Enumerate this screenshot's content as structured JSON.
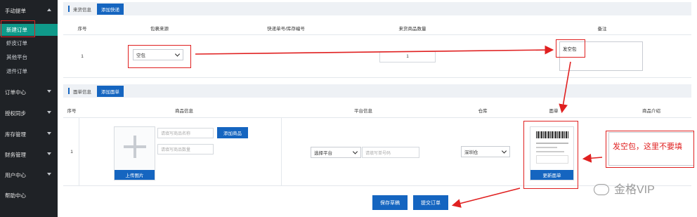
{
  "sidebar": {
    "group1": "手动提单",
    "items": [
      "新建订单",
      "虾皮订单",
      "其他平台",
      "退件订单"
    ],
    "groups": [
      "订单中心",
      "授权同步",
      "库存管理",
      "财务管理",
      "用户中心",
      "帮助中心"
    ]
  },
  "inbound": {
    "title": "来货信息",
    "add_btn": "添加快递",
    "headers": [
      "序号",
      "包裹来源",
      "快递单号/库存编号",
      "来货商品数量",
      "备注"
    ],
    "row": {
      "index": "1",
      "source": "空包",
      "quantity": "1",
      "remark": "发空包"
    }
  },
  "order": {
    "title": "面单信息",
    "add_btn": "添加面单",
    "headers": [
      "序号",
      "商品信息",
      "平台信息",
      "仓库",
      "面单",
      "商品介绍"
    ],
    "row": {
      "index": "1",
      "name_placeholder": "请填写商品名称",
      "qty_placeholder": "请填写商品数量",
      "add_goods": "添加商品",
      "upload": "上传图片",
      "platform": "选择平台",
      "order_placeholder": "请填写单号码",
      "warehouse": "深圳仓",
      "update_label": "更新面单",
      "intro": ""
    }
  },
  "footer": {
    "save": "保存草稿",
    "submit": "提交订单"
  },
  "annotation": {
    "note": "发空包，这里不要填"
  },
  "watermark": "金格VIP",
  "colors": {
    "accent": "#1565c0",
    "annotation": "#e02020",
    "sidebar_active": "#0f9a8a",
    "sidebar_bg": "#1f2226"
  }
}
